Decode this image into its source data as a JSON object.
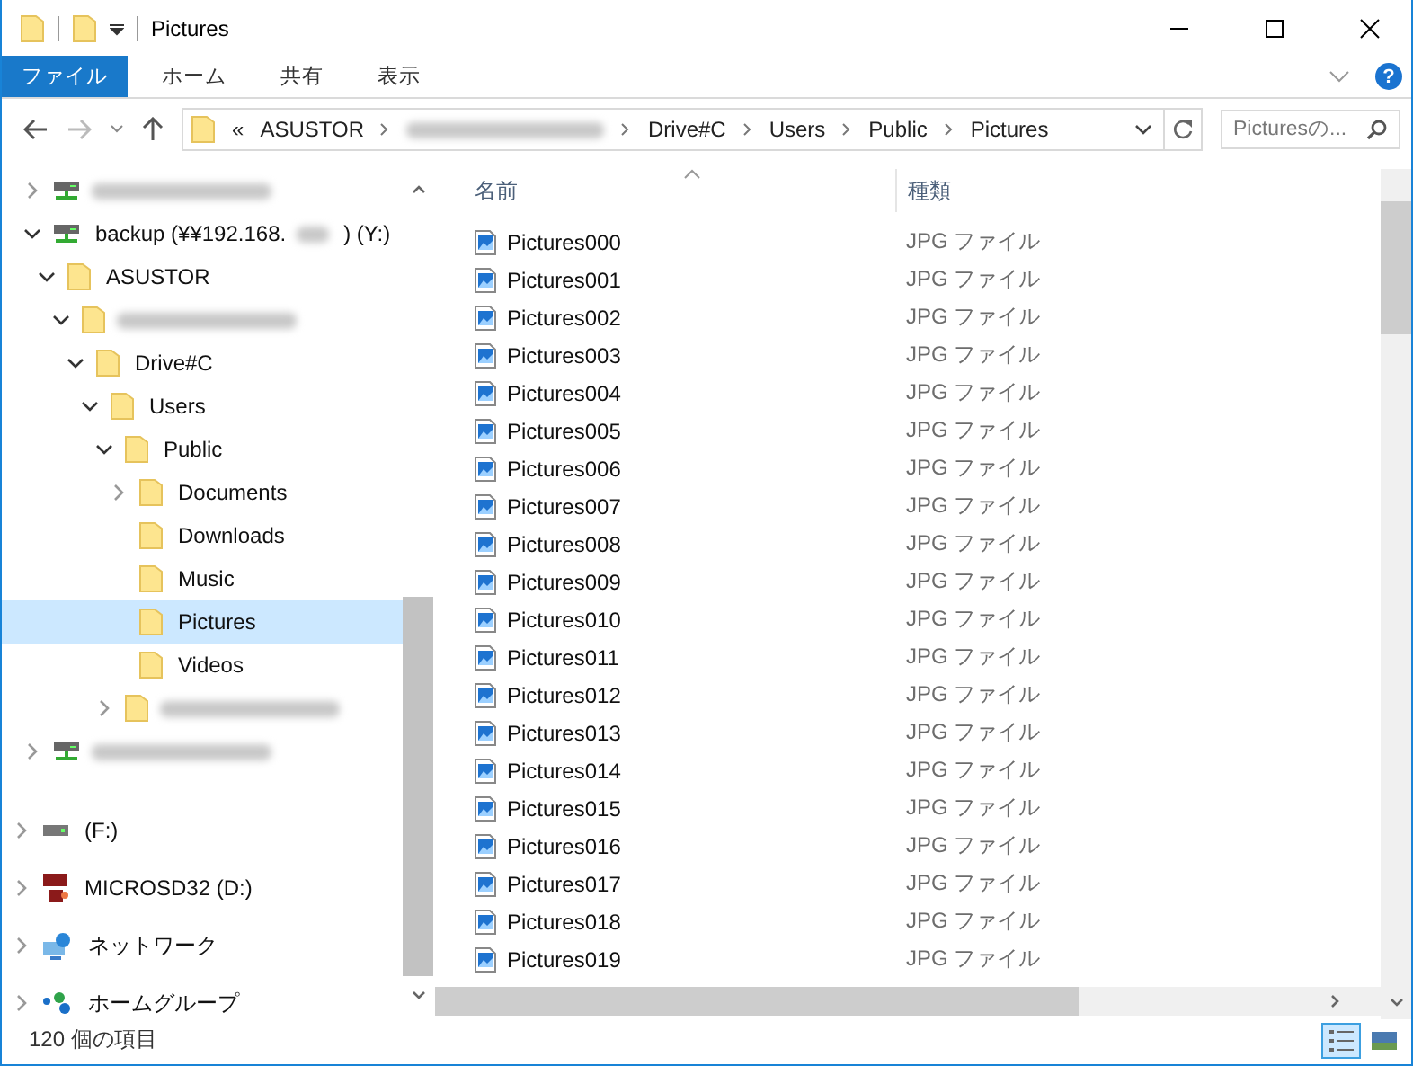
{
  "window": {
    "title": "Pictures"
  },
  "ribbon": {
    "tabs": [
      {
        "label": "ファイル",
        "selected": true
      },
      {
        "label": "ホーム",
        "selected": false
      },
      {
        "label": "共有",
        "selected": false
      },
      {
        "label": "表示",
        "selected": false
      }
    ],
    "help": "?"
  },
  "address": {
    "overflow": "«",
    "crumbs": [
      {
        "label": "ASUSTOR"
      },
      {
        "blurred": true
      },
      {
        "label": "Drive#C"
      },
      {
        "label": "Users"
      },
      {
        "label": "Public"
      },
      {
        "label": "Pictures"
      }
    ]
  },
  "search": {
    "placeholder": "Picturesの..."
  },
  "tree": [
    {
      "kind": "netdrive",
      "blurred": true,
      "expanded": false
    },
    {
      "kind": "netdrive",
      "label": "backup (¥¥192.168.",
      "blurred": true,
      "label_after": ") (Y:)",
      "expanded": true,
      "children": [
        {
          "kind": "folder",
          "label": "ASUSTOR",
          "expanded": true,
          "children": [
            {
              "kind": "folder",
              "blurred": true,
              "expanded": true,
              "children": [
                {
                  "kind": "folder",
                  "label": "Drive#C",
                  "expanded": true,
                  "children": [
                    {
                      "kind": "folder",
                      "label": "Users",
                      "expanded": true,
                      "children": [
                        {
                          "kind": "folder",
                          "label": "Public",
                          "expanded": true,
                          "children": [
                            {
                              "kind": "folder",
                              "label": "Documents",
                              "expanded": false
                            },
                            {
                              "kind": "folder",
                              "label": "Downloads"
                            },
                            {
                              "kind": "folder",
                              "label": "Music"
                            },
                            {
                              "kind": "folder",
                              "label": "Pictures",
                              "selected": true
                            },
                            {
                              "kind": "folder",
                              "label": "Videos"
                            }
                          ]
                        },
                        {
                          "kind": "folder",
                          "blurred": true,
                          "expanded": false
                        }
                      ]
                    }
                  ]
                }
              ]
            }
          ]
        }
      ]
    },
    {
      "kind": "netdrive",
      "blurred": true,
      "expanded": false
    }
  ],
  "roots": [
    {
      "kind": "drive",
      "label": "(F:)",
      "expanded": false
    },
    {
      "kind": "sd",
      "label": "MICROSD32 (D:)",
      "expanded": false
    },
    {
      "kind": "network",
      "label": "ネットワーク",
      "expanded": false
    },
    {
      "kind": "homegroup",
      "label": "ホームグループ",
      "expanded": false
    }
  ],
  "table": {
    "columns": [
      "名前",
      "種類"
    ],
    "rows": [
      [
        "Pictures000",
        "JPG ファイル"
      ],
      [
        "Pictures001",
        "JPG ファイル"
      ],
      [
        "Pictures002",
        "JPG ファイル"
      ],
      [
        "Pictures003",
        "JPG ファイル"
      ],
      [
        "Pictures004",
        "JPG ファイル"
      ],
      [
        "Pictures005",
        "JPG ファイル"
      ],
      [
        "Pictures006",
        "JPG ファイル"
      ],
      [
        "Pictures007",
        "JPG ファイル"
      ],
      [
        "Pictures008",
        "JPG ファイル"
      ],
      [
        "Pictures009",
        "JPG ファイル"
      ],
      [
        "Pictures010",
        "JPG ファイル"
      ],
      [
        "Pictures011",
        "JPG ファイル"
      ],
      [
        "Pictures012",
        "JPG ファイル"
      ],
      [
        "Pictures013",
        "JPG ファイル"
      ],
      [
        "Pictures014",
        "JPG ファイル"
      ],
      [
        "Pictures015",
        "JPG ファイル"
      ],
      [
        "Pictures016",
        "JPG ファイル"
      ],
      [
        "Pictures017",
        "JPG ファイル"
      ],
      [
        "Pictures018",
        "JPG ファイル"
      ],
      [
        "Pictures019",
        "JPG ファイル"
      ]
    ]
  },
  "status_bar": {
    "count": "120 個の項目",
    "views": [
      {
        "kind": "details",
        "selected": true
      },
      {
        "kind": "thumbnails",
        "selected": false
      }
    ]
  }
}
